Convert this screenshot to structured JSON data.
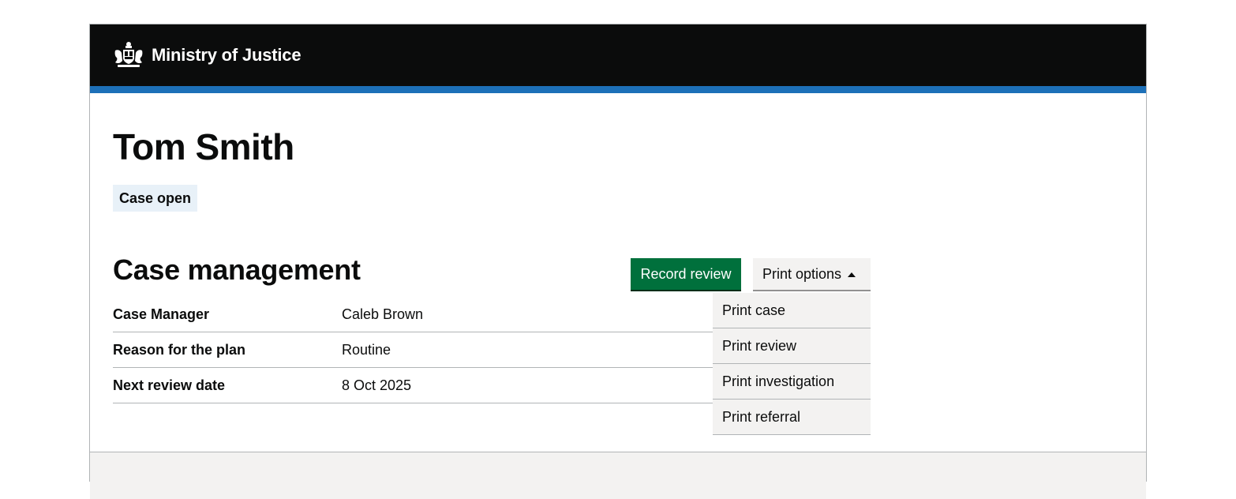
{
  "header": {
    "service_name": "Ministry of Justice",
    "logo_icon": "royal-coat-of-arms-icon",
    "colors": {
      "background": "#0b0c0c",
      "stripe": "#1d70b8"
    }
  },
  "person": {
    "name": "Tom Smith",
    "status": "Case open"
  },
  "case_management": {
    "title": "Case management",
    "record_review_label": "Record review",
    "print_options_label": "Print options",
    "print_menu": [
      "Print case",
      "Print review",
      "Print investigation",
      "Print referral"
    ],
    "rows": [
      {
        "key": "Case Manager",
        "value": "Caleb Brown"
      },
      {
        "key": "Reason for the plan",
        "value": "Routine"
      },
      {
        "key": "Next review date",
        "value": "8 Oct 2025"
      }
    ]
  },
  "colors": {
    "primary_button": "#00703c",
    "secondary_button": "#f3f2f1",
    "tag_background": "#e8f1f8"
  }
}
